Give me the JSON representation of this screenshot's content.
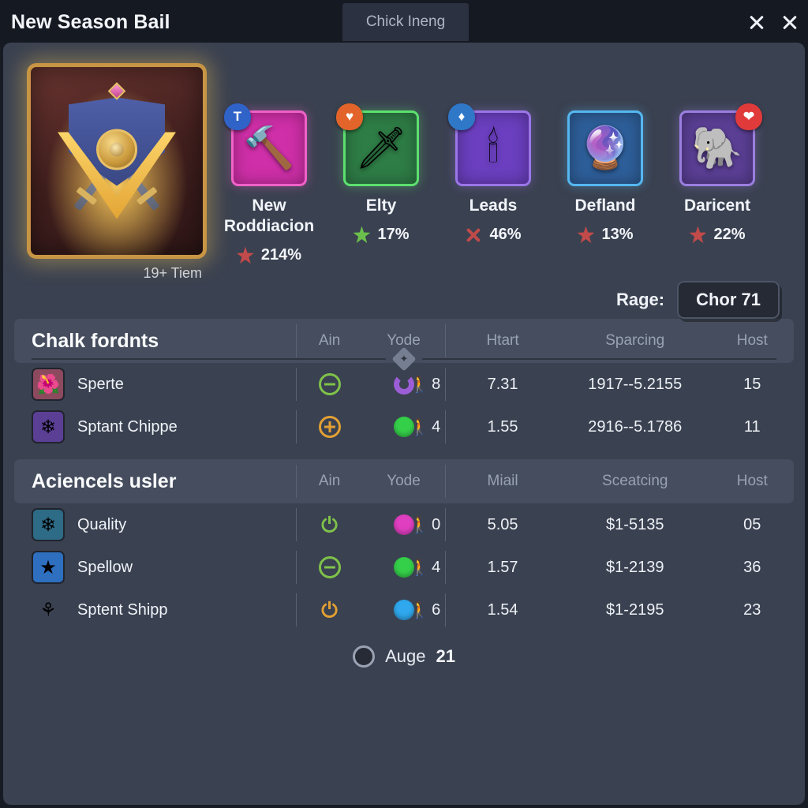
{
  "window": {
    "title": "New Season Bail",
    "tab_label": "Chick Ineng",
    "close_icon_1": "close-icon",
    "close_icon_2": "close-icon"
  },
  "hero": {
    "label": "19+ Tiem",
    "art_icon": "shield-crest-icon"
  },
  "items": [
    {
      "name": "New Roddiacion",
      "art": "🔨",
      "tile_bg": "#cf2fa8",
      "tile_border": "#ef62c8",
      "badge": "T",
      "badge_bg": "#2f63c8",
      "badge_side": "left",
      "stat_value": "214%",
      "stat_icon": "star-red",
      "stat_color": "#c14a4a"
    },
    {
      "name": "Elty",
      "art": "🗡",
      "tile_bg": "#2e7d46",
      "tile_border": "#5ce06f",
      "badge": "♥",
      "badge_bg": "#e2642a",
      "badge_side": "left",
      "stat_value": "17%",
      "stat_icon": "star-green",
      "stat_color": "#6bbf4d"
    },
    {
      "name": "Leads",
      "art": "🕯",
      "tile_bg": "#6b3fbf",
      "tile_border": "#9a76e8",
      "badge": "♦",
      "badge_bg": "#2f78c8",
      "badge_side": "left",
      "stat_value": "46%",
      "stat_icon": "x-red",
      "stat_color": "#c14a4a"
    },
    {
      "name": "Defland",
      "art": "🔮",
      "tile_bg": "#2e5f9a",
      "tile_border": "#55b7f0",
      "badge": "",
      "badge_bg": "",
      "badge_side": "none",
      "stat_value": "13%",
      "stat_icon": "star-red",
      "stat_color": "#c14a4a"
    },
    {
      "name": "Daricent",
      "art": "🐘",
      "tile_bg": "#5b3f95",
      "tile_border": "#9b7ee0",
      "badge": "❤",
      "badge_bg": "#e03a3a",
      "badge_side": "right",
      "stat_value": "22%",
      "stat_icon": "star-red",
      "stat_color": "#c14a4a"
    }
  ],
  "rage": {
    "label": "Rage:",
    "button_value": "Chor 71"
  },
  "sections": [
    {
      "title": "Chalk fordnts",
      "columns": [
        "Ain",
        "Yode",
        "Htart",
        "Sparcing",
        "Host"
      ],
      "rows": [
        {
          "icon": "🌺",
          "icon_bg": "#8d4a5e",
          "name": "Sperte",
          "ain_style": "green-minus",
          "dot": "arc-purple",
          "dot_color": "#9b5ed6",
          "yode": "8",
          "v1": "7.31",
          "v2": "1917--5.2155",
          "host": "15"
        },
        {
          "icon": "❄",
          "icon_bg": "#5b3f95",
          "name": "Sptant Chippe",
          "ain_style": "orange-plus",
          "dot": "solid-green",
          "dot_color": "#35d04a",
          "yode": "4",
          "v1": "1.55",
          "v2": "2916--5.1786",
          "host": "11"
        }
      ]
    },
    {
      "title": "Aciencels usler",
      "columns": [
        "Ain",
        "Yode",
        "Miail",
        "Sceatcing",
        "Host"
      ],
      "rows": [
        {
          "icon": "❄",
          "icon_bg": "#2d6b86",
          "name": "Quality",
          "ain_style": "power-green",
          "dot": "solid-magenta",
          "dot_color": "#e03fc0",
          "yode": "0",
          "v1": "5.05",
          "v2": "$1-5135",
          "host": "05"
        },
        {
          "icon": "★",
          "icon_bg": "#2e6fc0",
          "name": "Spellow",
          "ain_style": "green-minus",
          "dot": "solid-green",
          "dot_color": "#35d04a",
          "yode": "4",
          "v1": "1.57",
          "v2": "$1-2139",
          "host": "36"
        },
        {
          "icon": "⚘",
          "icon_bg": "transparent",
          "name": "Sptent Shipp",
          "ain_style": "power-orange",
          "dot": "solid-blue",
          "dot_color": "#2fa8ee",
          "yode": "6",
          "v1": "1.54",
          "v2": "$1-2195",
          "host": "23"
        }
      ]
    }
  ],
  "footer": {
    "label": "Auge",
    "value": "21"
  }
}
